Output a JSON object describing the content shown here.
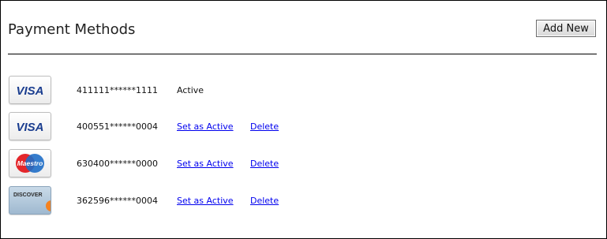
{
  "header": {
    "title": "Payment Methods",
    "add_button_label": "Add New"
  },
  "methods": [
    {
      "card_type": "VISA",
      "card_icon": "visa-card-icon",
      "number": "411111******1111",
      "status": "Active",
      "set_active_label": "",
      "delete_label": ""
    },
    {
      "card_type": "VISA",
      "card_icon": "visa-card-icon",
      "number": "400551******0004",
      "status": "",
      "set_active_label": "Set as Active",
      "delete_label": "Delete"
    },
    {
      "card_type": "Maestro",
      "card_icon": "maestro-card-icon",
      "number": "630400******0000",
      "status": "",
      "set_active_label": "Set as Active",
      "delete_label": "Delete"
    },
    {
      "card_type": "DISCOVER",
      "card_icon": "discover-card-icon",
      "number": "362596******0004",
      "status": "",
      "set_active_label": "Set as Active",
      "delete_label": "Delete"
    }
  ],
  "colors": {
    "link": "#0000ee",
    "visa_blue": "#1a3d8f",
    "maestro_red": "#e3262b",
    "maestro_blue": "#1f6ec7",
    "discover_orange": "#f58220",
    "discover_bg": "#a9c2d8"
  }
}
